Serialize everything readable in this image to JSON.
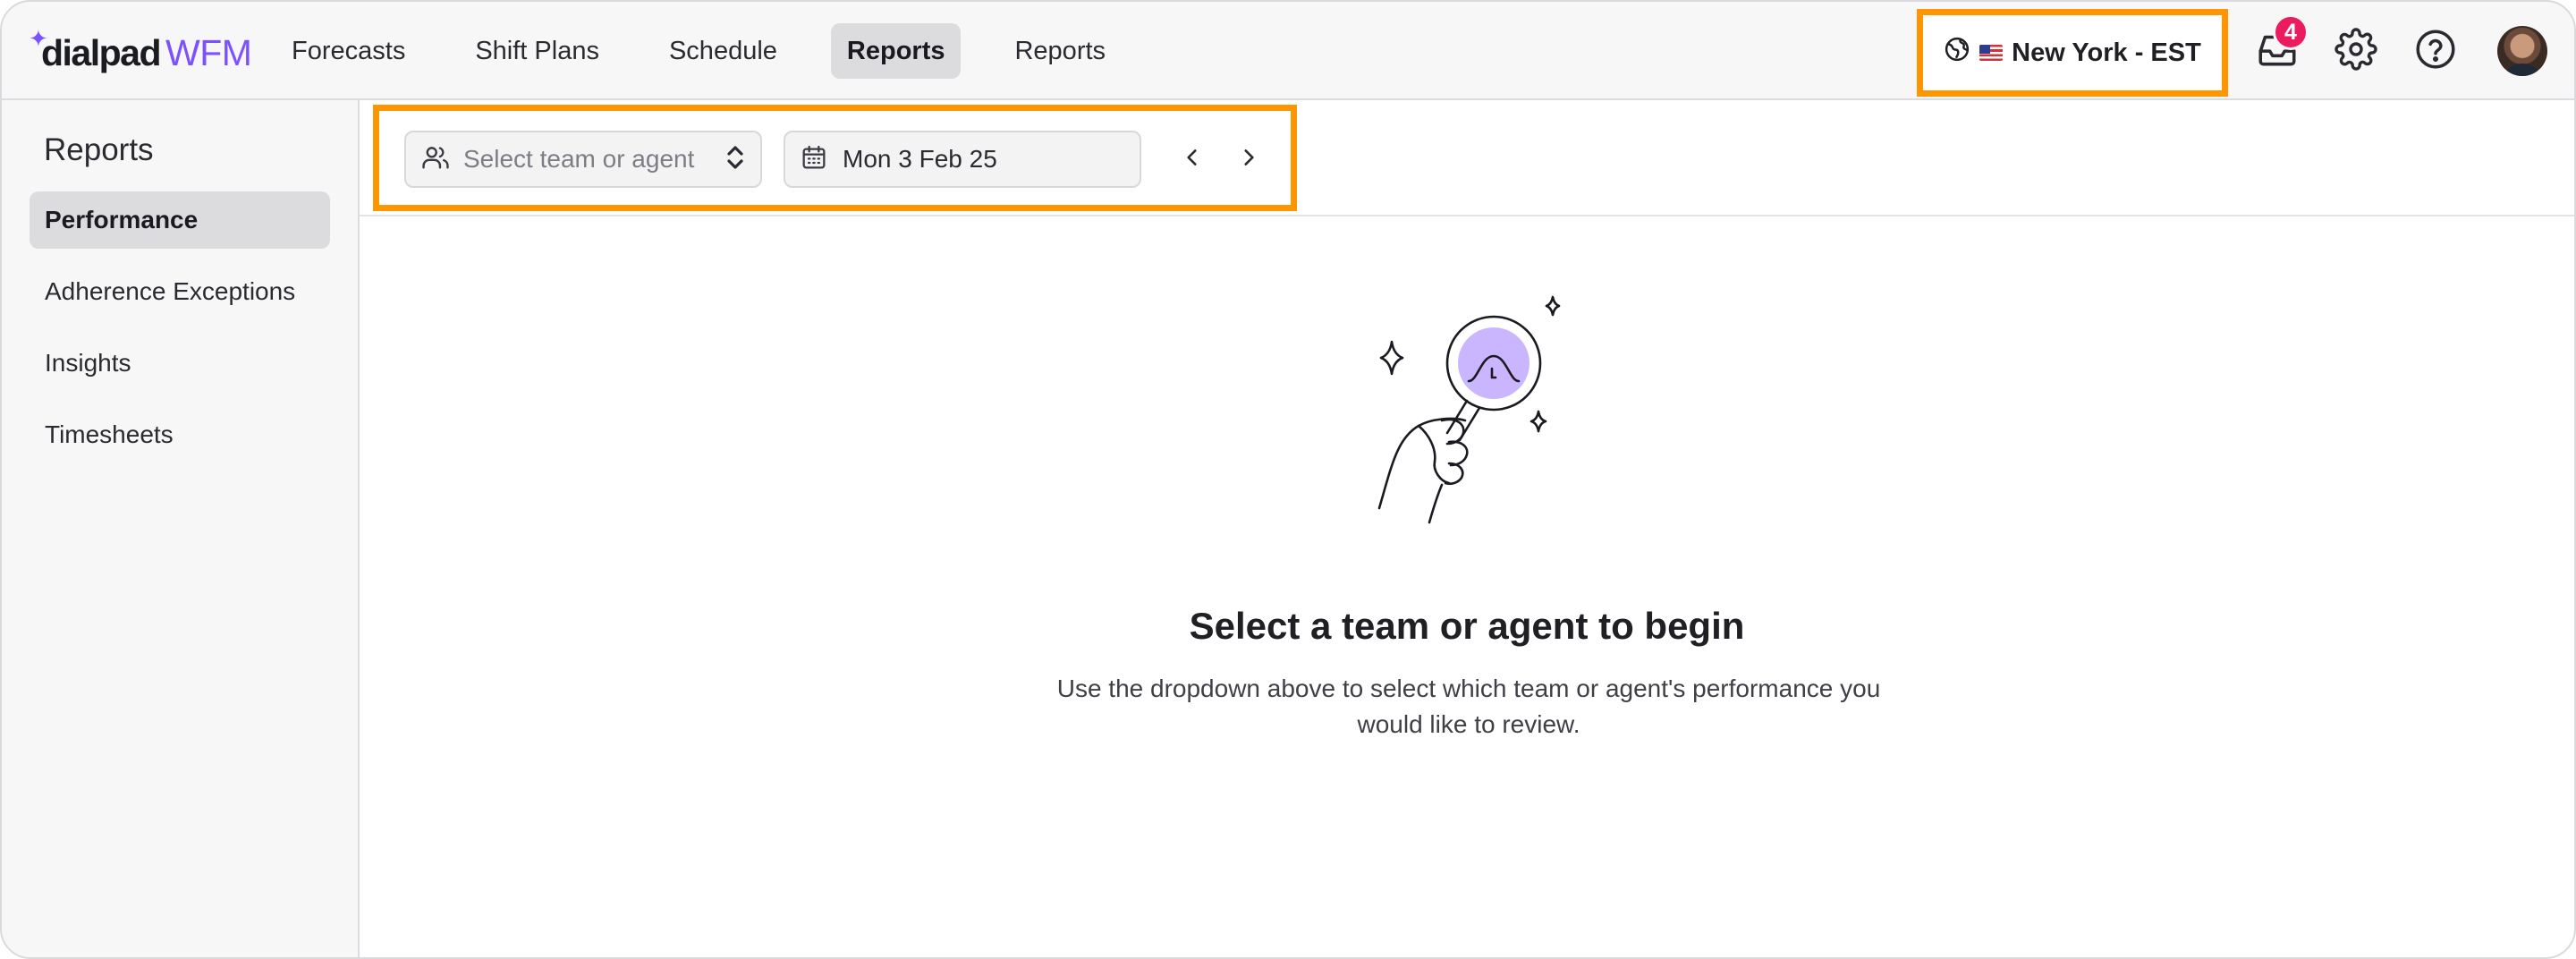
{
  "app": {
    "logo_word": "dialpad",
    "logo_product": "WFM"
  },
  "nav": {
    "items": [
      {
        "label": "Forecasts"
      },
      {
        "label": "Shift Plans"
      },
      {
        "label": "Schedule"
      },
      {
        "label": "Reports",
        "active": true
      },
      {
        "label": "Reports"
      }
    ]
  },
  "header": {
    "timezone_label": "New York - EST",
    "inbox_count": "4",
    "icons": [
      "globe-icon",
      "us-flag-icon",
      "inbox-icon",
      "settings-icon",
      "help-icon",
      "avatar"
    ]
  },
  "sidebar": {
    "title": "Reports",
    "items": [
      {
        "label": "Performance",
        "active": true
      },
      {
        "label": "Adherence Exceptions"
      },
      {
        "label": "Insights"
      },
      {
        "label": "Timesheets"
      }
    ]
  },
  "toolbar": {
    "team_placeholder": "Select team or agent",
    "date_value": "Mon 3 Feb 25",
    "icons": [
      "users-icon",
      "updown-icon",
      "calendar-icon",
      "chevron-left-icon",
      "chevron-right-icon"
    ]
  },
  "empty_state": {
    "title": "Select a team or agent to begin",
    "description": "Use the dropdown above to select which team or agent's performance you would like to review."
  },
  "colors": {
    "accent": "#7c52ff",
    "highlight": "#ff9500",
    "badge": "#ea1b5e",
    "illustration_fill": "#c9b6ff"
  }
}
